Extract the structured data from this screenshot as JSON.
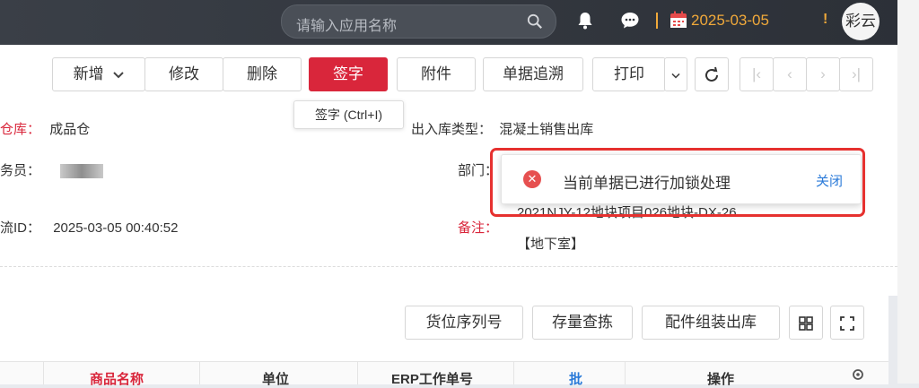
{
  "header": {
    "search_placeholder": "请输入应用名称",
    "date": "2025-03-05",
    "alert": "!",
    "user": "彩云"
  },
  "toolbar": {
    "add": "新增",
    "edit": "修改",
    "delete": "删除",
    "sign": "签字",
    "attach": "附件",
    "trace": "单据追溯",
    "print": "打印",
    "sign_tooltip": "签字 (Ctrl+I)"
  },
  "form": {
    "warehouse_label": "仓库：",
    "warehouse_value": "成品仓",
    "io_type_label": "出入库类型：",
    "io_type_value": "混凝土销售出库",
    "staff_label": "务员：",
    "dept_label": "部门：",
    "flow_id_label": "流ID：",
    "flow_id_value": "2025-03-05 00:40:52",
    "remark_label": "备注：",
    "remark_line1": "2021NJY-12地块项目026地块-DX-26",
    "remark_line2": "【地下室】"
  },
  "toast": {
    "message": "当前单据已进行加锁处理",
    "close": "关闭"
  },
  "detail": {
    "buttons": [
      "货位序列号",
      "存量查拣",
      "配件组装出库"
    ],
    "columns": [
      "商品名称",
      "单位",
      "ERP工作单号",
      "批",
      "操作"
    ]
  },
  "colors": {
    "accent": "#d9263b",
    "date": "#f0a93a",
    "link": "#2a7ad8"
  }
}
